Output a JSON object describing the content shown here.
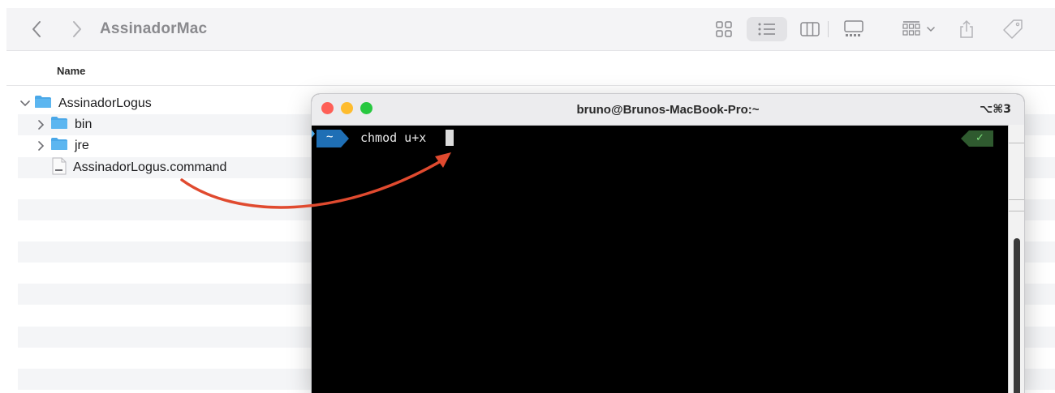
{
  "finder": {
    "title": "AssinadorMac",
    "column_header": "Name",
    "items": [
      {
        "name": "AssinadorLogus",
        "kind": "folder",
        "expanded": true
      },
      {
        "name": "bin",
        "kind": "folder",
        "expanded": false
      },
      {
        "name": "jre",
        "kind": "folder",
        "expanded": false
      },
      {
        "name": "AssinadorLogus.command",
        "kind": "file"
      }
    ],
    "toolbar_icons": [
      "back-icon",
      "forward-icon",
      "icon-view-icon",
      "list-view-icon",
      "column-view-icon",
      "gallery-view-icon",
      "group-by-icon",
      "share-icon",
      "tag-icon"
    ]
  },
  "terminal": {
    "title": "bruno@Brunos-MacBook-Pro:~",
    "shortcut": "⌥⌘3",
    "prompt_dir": "~",
    "command": "chmod u+x",
    "status_check": "✓"
  },
  "colors": {
    "folder_blue": "#4aa8e8",
    "prompt_blue": "#1f6fb5",
    "arrow_red": "#e04a2f",
    "traffic_red": "#fe5f57",
    "traffic_yellow": "#febc2e",
    "traffic_green": "#28c840",
    "status_green": "#2f8a2f"
  }
}
